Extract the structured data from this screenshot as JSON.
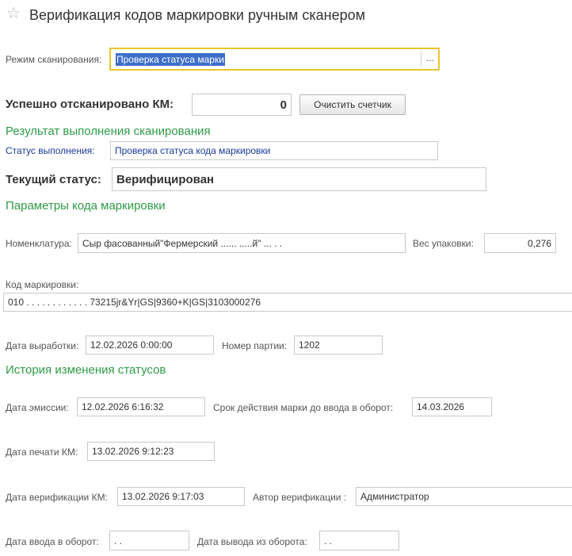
{
  "header": {
    "title": "Верификация кодов маркировки ручным сканером",
    "favorite_icon": "star-icon"
  },
  "scan_mode": {
    "label": "Режим сканирования:",
    "value": "Проверка статуса марки",
    "choose_button_label": "..."
  },
  "counter": {
    "label": "Успешно отсканировано КМ:",
    "value": "0",
    "clear_button_label": "Очистить счетчик"
  },
  "scan_result": {
    "section_title": "Результат выполнения сканирования",
    "status_label": "Статус выполнения:",
    "status_value": "Проверка статуса кода маркировки",
    "current_status_label": "Текущий статус:",
    "current_status_value": "Верифицирован"
  },
  "code_params": {
    "section_title": "Параметры кода маркировки",
    "nomenclature_label": "Номенклатура:",
    "nomenclature_value": "Сыр фасованный\"Фермерский ...... .....й\" ...  . .",
    "weight_label": "Вес упаковки:",
    "weight_value": "0,276",
    "code_label": "Код маркировки:",
    "code_value": "010 . . . . . . . . . . . . 73215jr&Yr|GS|9360+K|GS|3103000276",
    "production_date_label": "Дата выработки:",
    "production_date_value": "12.02.2026  0:00:00",
    "batch_label": "Номер партии:",
    "batch_value": "1202"
  },
  "history": {
    "section_title": "История изменения статусов",
    "emission_date_label": "Дата эмиссии:",
    "emission_date_value": "12.02.2026  6:16:32",
    "expiry_label": "Срок действия марки до ввода в оборот:",
    "expiry_value": "14.03.2026",
    "print_date_label": "Дата печати КМ:",
    "print_date_value": "13.02.2026  9:12:23",
    "verification_date_label": "Дата верификации КМ:",
    "verification_date_value": "13.02.2026  9:17:03",
    "verification_author_label": "Автор верификации :",
    "verification_author_value": "Администратор",
    "circulation_in_label": "Дата ввода в оборот:",
    "circulation_in_value": " .  .",
    "circulation_out_label": "Дата вывода из оборота:",
    "circulation_out_value": " .  ."
  },
  "colors": {
    "section_green": "#2f9b48",
    "focus_yellow": "#e8c62e",
    "selection_blue": "#3d6fc9",
    "link_blue": "#1a3a9c"
  }
}
